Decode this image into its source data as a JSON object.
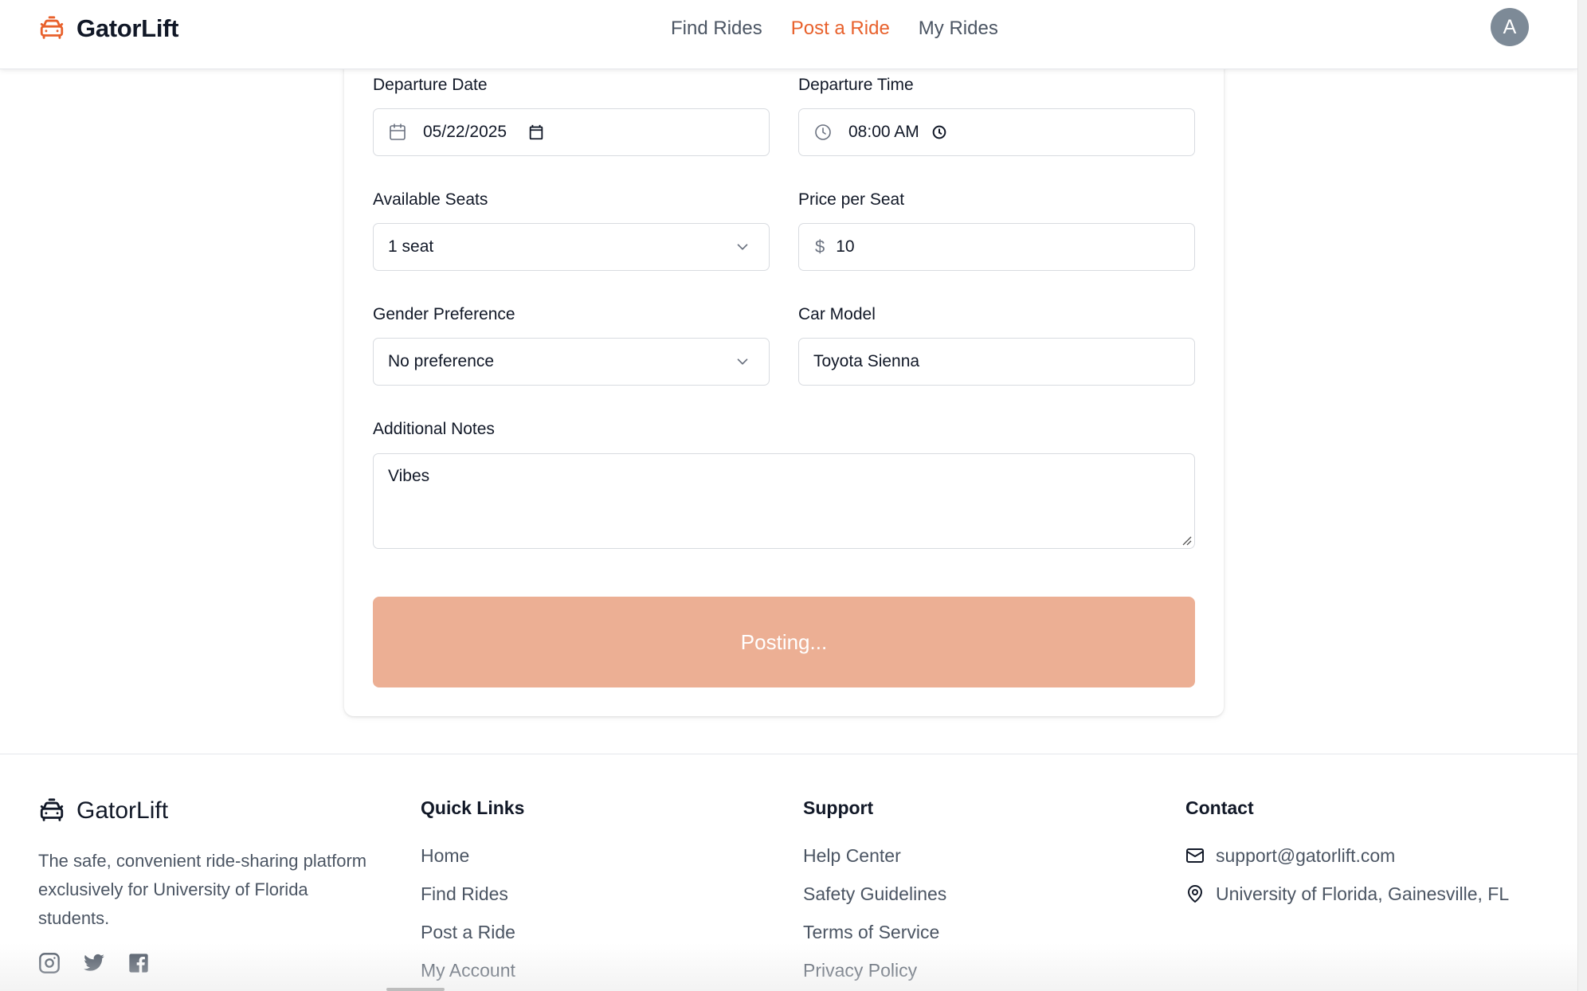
{
  "header": {
    "brand": "GatorLift",
    "nav": [
      {
        "label": "Find Rides",
        "active": false
      },
      {
        "label": "Post a Ride",
        "active": true
      },
      {
        "label": "My Rides",
        "active": false
      }
    ],
    "avatar_initial": "A"
  },
  "form": {
    "departure_date": {
      "label": "Departure Date",
      "value": "05/22/2025"
    },
    "departure_time": {
      "label": "Departure Time",
      "value": "08:00  AM"
    },
    "available_seats": {
      "label": "Available Seats",
      "value": "1 seat"
    },
    "price_per_seat": {
      "label": "Price per Seat",
      "currency": "$",
      "value": "10"
    },
    "gender_preference": {
      "label": "Gender Preference",
      "value": "No preference"
    },
    "car_model": {
      "label": "Car Model",
      "value": "Toyota Sienna"
    },
    "additional_notes": {
      "label": "Additional Notes",
      "value": "Vibes"
    },
    "submit_label": "Posting..."
  },
  "footer": {
    "brand": "GatorLift",
    "description": "The safe, convenient ride-sharing platform exclusively for University of Florida students.",
    "socials": [
      "instagram-icon",
      "twitter-icon",
      "facebook-icon"
    ],
    "quick_links": {
      "title": "Quick Links",
      "items": [
        "Home",
        "Find Rides",
        "Post a Ride",
        "My Account"
      ]
    },
    "support": {
      "title": "Support",
      "items": [
        "Help Center",
        "Safety Guidelines",
        "Terms of Service",
        "Privacy Policy"
      ]
    },
    "contact": {
      "title": "Contact",
      "email": "support@gatorlift.com",
      "location": "University of Florida, Gainesville, FL"
    }
  },
  "colors": {
    "accent": "#e8612c",
    "button_disabled": "#ecaf94"
  }
}
